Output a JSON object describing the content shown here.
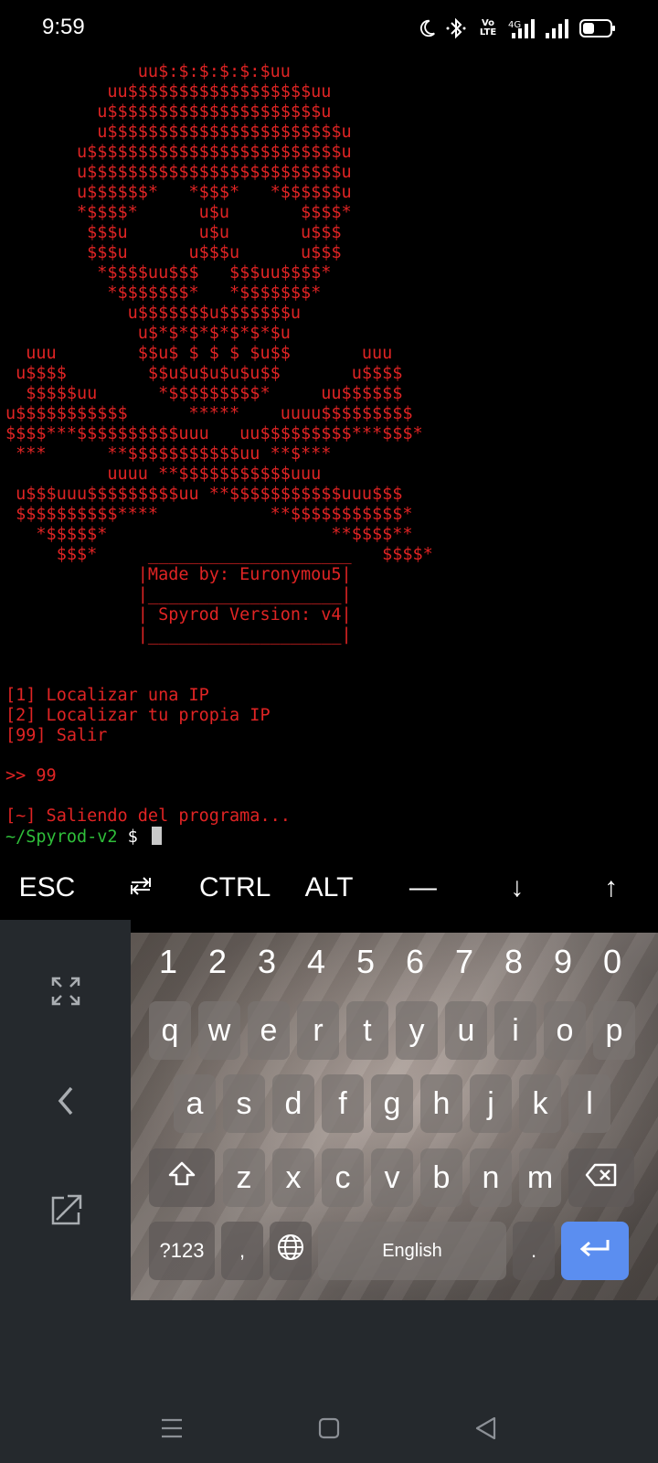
{
  "status_bar": {
    "time": "9:59",
    "icons": [
      "moon-icon",
      "bluetooth-icon",
      "volte-icon",
      "4g-signal-icon",
      "signal-icon",
      "battery-icon"
    ],
    "volte_text": "Vo LTE",
    "network": "4G"
  },
  "terminal": {
    "art": "             uu$:$:$:$:$:$uu\n          uu$$$$$$$$$$$$$$$$$$uu\n         u$$$$$$$$$$$$$$$$$$$$$u\n         u$$$$$$$$$$$$$$$$$$$$$$$u\n       u$$$$$$$$$$$$$$$$$$$$$$$$$u\n       u$$$$$$$$$$$$$$$$$$$$$$$$$u\n       u$$$$$$*   *$$$*   *$$$$$$u\n       *$$$$*      u$u       $$$$*\n        $$$u       u$u       u$$$\n        $$$u      u$$$u      u$$$\n         *$$$$uu$$$   $$$uu$$$$*\n          *$$$$$$$*   *$$$$$$$*\n            u$$$$$$$u$$$$$$$u\n             u$*$*$*$*$*$*$u\n  uuu        $$u$ $ $ $ $u$$       uuu\n u$$$$        $$u$u$u$u$u$$       u$$$$\n  $$$$$uu      *$$$$$$$$$*     uu$$$$$$\nu$$$$$$$$$$$      *****    uuuu$$$$$$$$$\n$$$$***$$$$$$$$$$uuu   uu$$$$$$$$$***$$$*\n ***      **$$$$$$$$$$$uu **$***\n          uuuu **$$$$$$$$$$$uuu\n u$$$uuu$$$$$$$$$uu **$$$$$$$$$$$uuu$$$\n $$$$$$$$$$****           **$$$$$$$$$$$*\n   *$$$$$*                      **$$$$**\n     $$$*     ____________________   $$$$*\n             |Made by: Euronymou5|\n             |___________________|\n             | Spyrod Version: v4|\n             |___________________|",
    "menu_items": [
      "[1] Localizar una IP",
      "[2] Localizar tu propia IP",
      "[99] Salir"
    ],
    "input_line": ">> 99",
    "exit_message": "[~] Saliendo del programa...",
    "prompt_cwd": "~/Spyrod-v2",
    "prompt_symbol": " $ "
  },
  "extra_keys": [
    "ESC",
    "tab-icon",
    "CTRL",
    "ALT",
    "—",
    "↓",
    "↑"
  ],
  "extra_key_labels": {
    "esc": "ESC",
    "tab": "⭾",
    "ctrl": "CTRL",
    "alt": "ALT",
    "dash": "—",
    "down": "↓",
    "up": "↑"
  },
  "keyboard": {
    "numbers": [
      "1",
      "2",
      "3",
      "4",
      "5",
      "6",
      "7",
      "8",
      "9",
      "0"
    ],
    "row1": [
      "q",
      "w",
      "e",
      "r",
      "t",
      "y",
      "u",
      "i",
      "o",
      "p"
    ],
    "row2": [
      "a",
      "s",
      "d",
      "f",
      "g",
      "h",
      "j",
      "k",
      "l"
    ],
    "row3": [
      "z",
      "x",
      "c",
      "v",
      "b",
      "n",
      "m"
    ],
    "sym_label": "?123",
    "comma_label": ",",
    "space_label": "English",
    "period_label": "."
  },
  "colors": {
    "terminal_text": "#e02424",
    "prompt_cwd": "#2fbf3a",
    "enter_key": "#5b8ef0",
    "panel_bg": "#25292d"
  }
}
